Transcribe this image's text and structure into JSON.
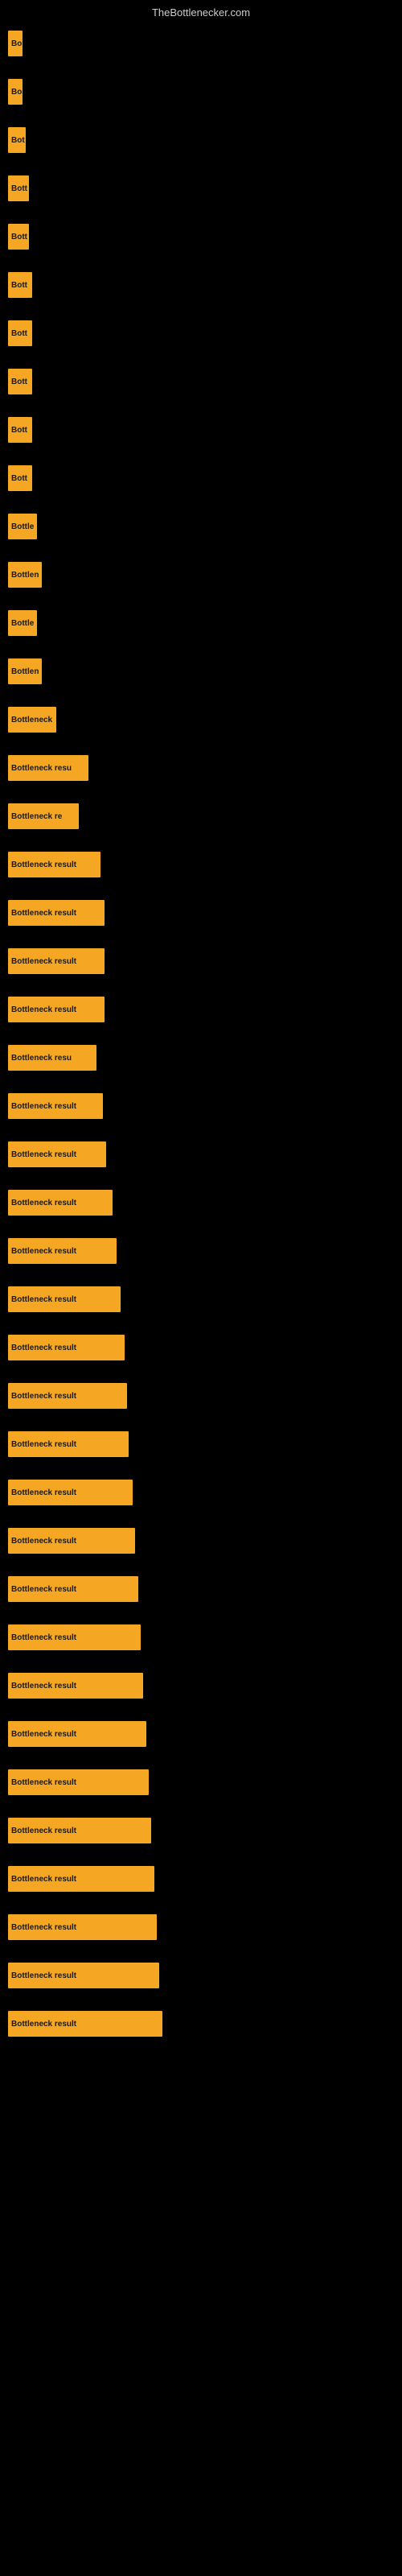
{
  "site": {
    "title": "TheBottlenecker.com"
  },
  "bars": [
    {
      "label": "Bo",
      "width": 18
    },
    {
      "label": "Bo",
      "width": 18
    },
    {
      "label": "Bot",
      "width": 22
    },
    {
      "label": "Bott",
      "width": 26
    },
    {
      "label": "Bott",
      "width": 26
    },
    {
      "label": "Bott",
      "width": 30
    },
    {
      "label": "Bott",
      "width": 30
    },
    {
      "label": "Bott",
      "width": 30
    },
    {
      "label": "Bott",
      "width": 30
    },
    {
      "label": "Bott",
      "width": 30
    },
    {
      "label": "Bottle",
      "width": 36
    },
    {
      "label": "Bottlen",
      "width": 42
    },
    {
      "label": "Bottle",
      "width": 36
    },
    {
      "label": "Bottlen",
      "width": 42
    },
    {
      "label": "Bottleneck",
      "width": 60
    },
    {
      "label": "Bottleneck resu",
      "width": 100
    },
    {
      "label": "Bottleneck re",
      "width": 88
    },
    {
      "label": "Bottleneck result",
      "width": 115
    },
    {
      "label": "Bottleneck result",
      "width": 120
    },
    {
      "label": "Bottleneck result",
      "width": 120
    },
    {
      "label": "Bottleneck result",
      "width": 120
    },
    {
      "label": "Bottleneck resu",
      "width": 110
    },
    {
      "label": "Bottleneck result",
      "width": 118
    },
    {
      "label": "Bottleneck result",
      "width": 122
    },
    {
      "label": "Bottleneck result",
      "width": 130
    },
    {
      "label": "Bottleneck result",
      "width": 135
    },
    {
      "label": "Bottleneck result",
      "width": 140
    },
    {
      "label": "Bottleneck result",
      "width": 145
    },
    {
      "label": "Bottleneck result",
      "width": 148
    },
    {
      "label": "Bottleneck result",
      "width": 150
    },
    {
      "label": "Bottleneck result",
      "width": 155
    },
    {
      "label": "Bottleneck result",
      "width": 158
    },
    {
      "label": "Bottleneck result",
      "width": 162
    },
    {
      "label": "Bottleneck result",
      "width": 165
    },
    {
      "label": "Bottleneck result",
      "width": 168
    },
    {
      "label": "Bottleneck result",
      "width": 172
    },
    {
      "label": "Bottleneck result",
      "width": 175
    },
    {
      "label": "Bottleneck result",
      "width": 178
    },
    {
      "label": "Bottleneck result",
      "width": 182
    },
    {
      "label": "Bottleneck result",
      "width": 185
    },
    {
      "label": "Bottleneck result",
      "width": 188
    },
    {
      "label": "Bottleneck result",
      "width": 192
    }
  ]
}
